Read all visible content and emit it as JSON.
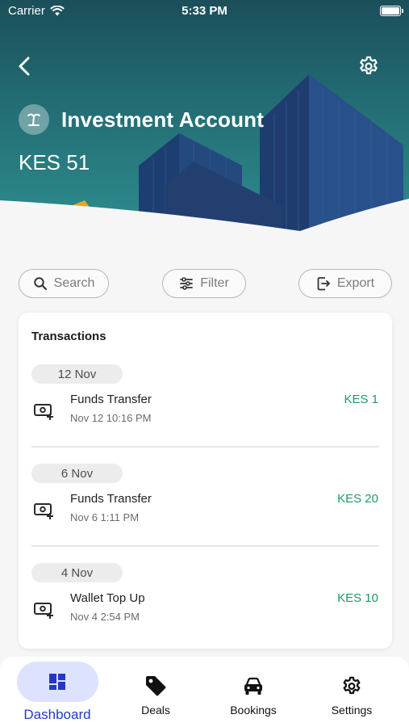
{
  "status_bar": {
    "carrier": "Carrier",
    "time": "5:33 PM"
  },
  "header": {
    "account_title": "Investment Account",
    "balance": "KES 51",
    "icons": {
      "back": "chevron-left-icon",
      "settings": "gear-icon",
      "account": "palm-tree-icon"
    }
  },
  "actions": {
    "search": "Search",
    "filter": "Filter",
    "export": "Export"
  },
  "transactions": {
    "title": "Transactions",
    "groups": [
      {
        "date": "12 Nov",
        "name": "Funds Transfer",
        "time": "Nov 12 10:16 PM",
        "amount": "KES 1"
      },
      {
        "date": "6 Nov",
        "name": "Funds Transfer",
        "time": "Nov 6 1:11 PM",
        "amount": "KES 20"
      },
      {
        "date": "4 Nov",
        "name": "Wallet Top Up",
        "time": "Nov 4 2:54 PM",
        "amount": "KES 10"
      }
    ]
  },
  "tabbar": {
    "items": [
      {
        "label": "Dashboard",
        "icon": "dashboard-grid-icon",
        "active": true
      },
      {
        "label": "Deals",
        "icon": "tag-icon",
        "active": false
      },
      {
        "label": "Bookings",
        "icon": "car-icon",
        "active": false
      },
      {
        "label": "Settings",
        "icon": "gear-icon",
        "active": false
      }
    ]
  },
  "colors": {
    "header_teal": "#236d74",
    "amount_green": "#1e9a63",
    "active_tab_bg": "#dde3ff",
    "active_tab_text": "#2438c8"
  }
}
